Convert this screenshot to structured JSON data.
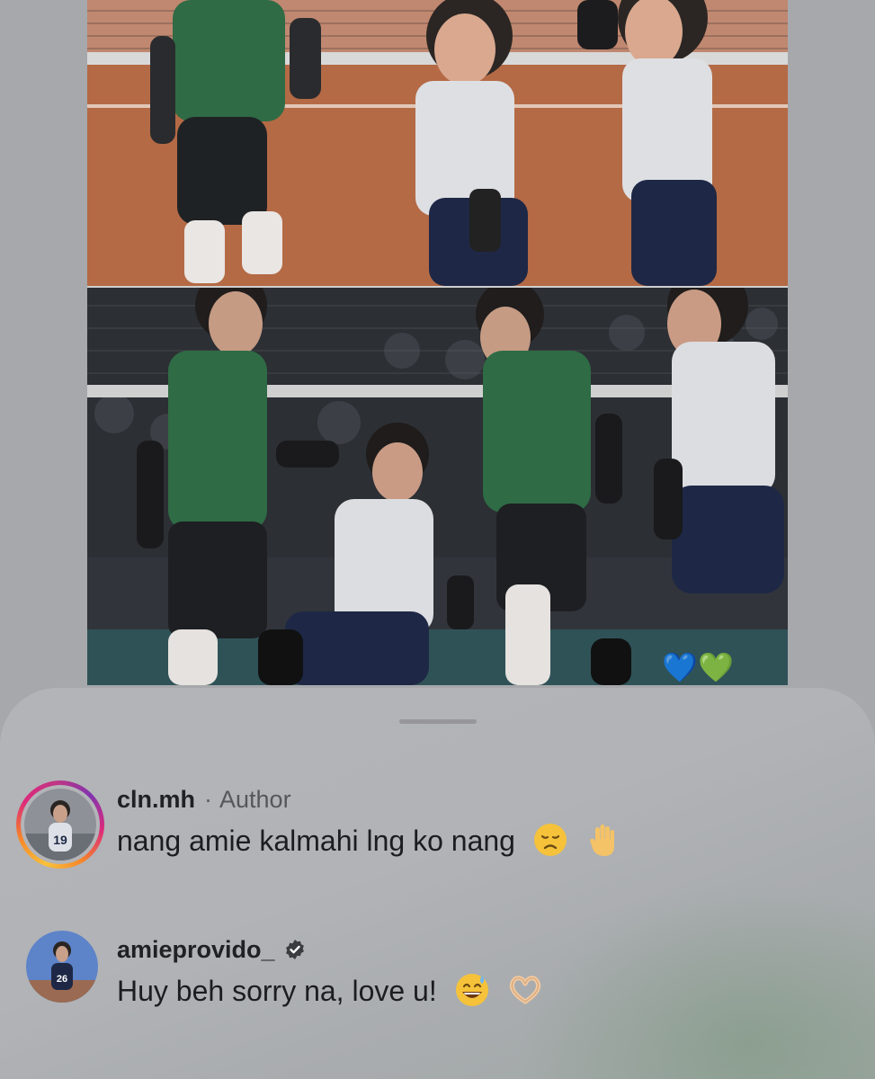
{
  "post": {
    "reaction_emojis": {
      "blue_heart": "💙",
      "green_heart": "💚"
    }
  },
  "comments": [
    {
      "username": "cln.mh",
      "separator": "·",
      "role": "Author",
      "text": "nang amie kalmahi lng ko nang",
      "emojis": [
        "disappointed-face-icon",
        "raised-hand-icon"
      ],
      "avatar_ring": true
    },
    {
      "username": "amieprovido_",
      "verified": true,
      "text": "Huy beh sorry na, love u!",
      "emojis": [
        "grinning-sweat-face-icon",
        "heart-hands-icon"
      ],
      "avatar_ring": false
    }
  ],
  "colors": {
    "username": "#202124",
    "meta": "#55575b",
    "ring_start": "#f9c23c",
    "ring_mid": "#dd2a7b",
    "ring_end": "#8134af"
  }
}
